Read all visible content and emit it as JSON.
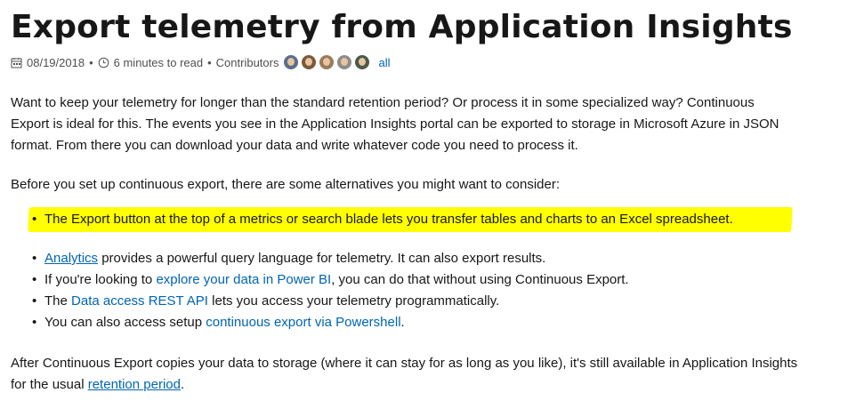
{
  "title": "Export telemetry from Application Insights",
  "meta": {
    "date": "08/19/2018",
    "separator": "•",
    "read_time": "6 minutes to read",
    "contributors_label": "Contributors",
    "all_link": "all",
    "avatars": [
      {
        "icon": "contributor-avatar",
        "color": "#5a6e8c"
      },
      {
        "icon": "contributor-avatar",
        "color": "#7a5a3c"
      },
      {
        "icon": "contributor-avatar",
        "color": "#9a7a5a"
      },
      {
        "icon": "contributor-avatar",
        "color": "#8c8c8c"
      },
      {
        "icon": "contributor-avatar",
        "color": "#4a5a4a"
      }
    ]
  },
  "intro": {
    "line1": "Want to keep your telemetry for longer than the standard retention period? Or process it in some specialized way? Continuous",
    "line2": "Export is ideal for this. The events you see in the Application Insights portal can be exported to storage in Microsoft Azure in JSON",
    "line3": "format. From there you can download your data and write whatever code you need to process it."
  },
  "alternatives_intro": "Before you set up continuous export, there are some alternatives you might want to consider:",
  "bullets": {
    "b1": {
      "text": "The Export button at the top of a metrics or search blade lets you transfer tables and charts to an Excel spreadsheet."
    },
    "b2": {
      "link": "Analytics",
      "text": " provides a powerful query language for telemetry. It can also export results."
    },
    "b3": {
      "before": "If you're looking to ",
      "link": "explore your data in Power BI",
      "after": ", you can do that without using Continuous Export."
    },
    "b4": {
      "before": "The ",
      "link": "Data access REST API",
      "after": " lets you access your telemetry programmatically."
    },
    "b5": {
      "before": "You can also access setup ",
      "link": "continuous export via Powershell",
      "after": "."
    }
  },
  "bullet_glyph": "•",
  "outro": {
    "line1": "After Continuous Export copies your data to storage (where it can stay for as long as you like), it's still available in Application Insights",
    "line2_before": "for the usual ",
    "line2_link": "retention period",
    "line2_after": "."
  },
  "colors": {
    "link": "#0065b3",
    "highlight": "#ffff00",
    "text": "#171717"
  }
}
